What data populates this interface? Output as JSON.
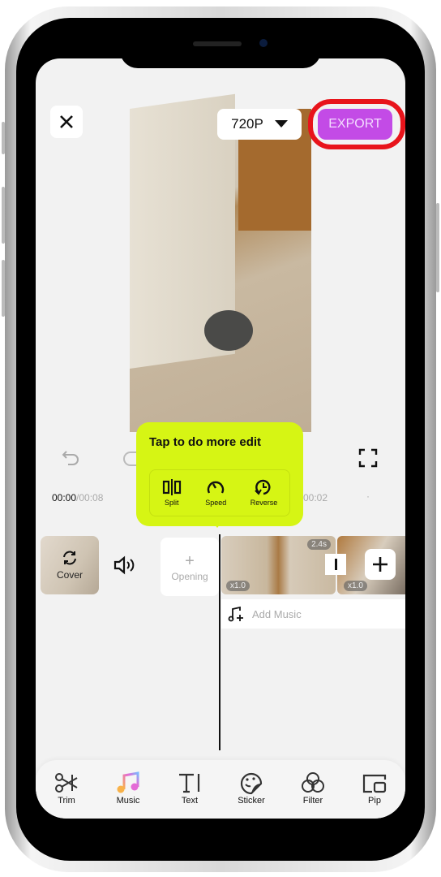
{
  "header": {
    "close_icon": "close-icon",
    "resolution": "720P",
    "export_label": "EXPORT",
    "export_color": "#c34be6",
    "highlight_color": "#e8141b"
  },
  "tooltip": {
    "title": "Tap to do more edit",
    "color": "#d6f514",
    "items": [
      {
        "label": "Split",
        "icon": "split-icon"
      },
      {
        "label": "Speed",
        "icon": "speed-icon"
      },
      {
        "label": "Reverse",
        "icon": "reverse-icon"
      }
    ]
  },
  "playback": {
    "current": "00:00",
    "total": "/00:08",
    "marker": "00:02",
    "marker_dot": "·"
  },
  "timeline": {
    "cover_label": "Cover",
    "opening_plus": "+",
    "opening_label": "Opening",
    "clip1_speed": "x1.0",
    "clip1_duration": "2.4s",
    "clip2_speed": "x1.0",
    "add_music": "Add Music"
  },
  "toolbar": {
    "items": [
      {
        "label": "Trim",
        "icon": "trim-icon"
      },
      {
        "label": "Music",
        "icon": "music-icon"
      },
      {
        "label": "Text",
        "icon": "text-icon"
      },
      {
        "label": "Sticker",
        "icon": "sticker-icon"
      },
      {
        "label": "Filter",
        "icon": "filter-icon"
      },
      {
        "label": "Pip",
        "icon": "pip-icon"
      }
    ]
  }
}
